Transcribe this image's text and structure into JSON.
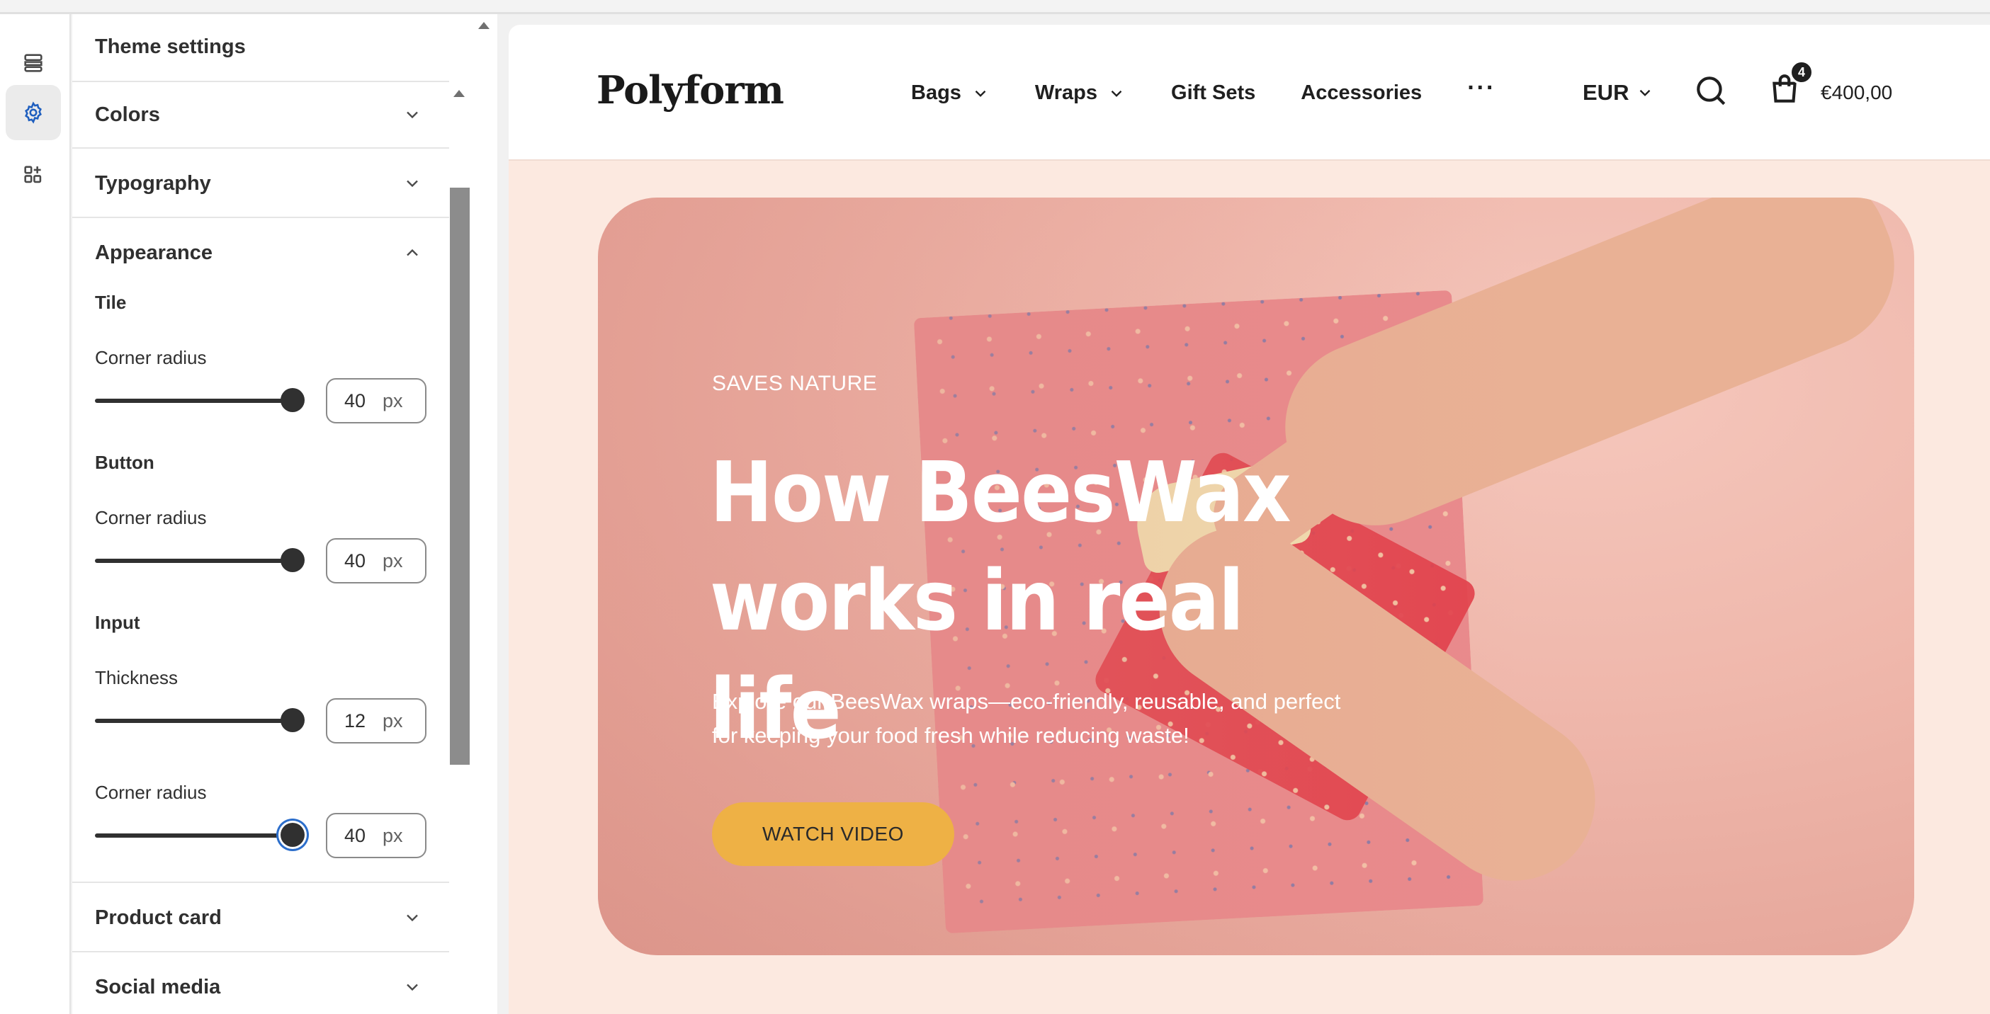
{
  "rail": {
    "items": [
      {
        "name": "sections",
        "icon": "sections-icon"
      },
      {
        "name": "theme-settings",
        "icon": "gear-icon",
        "active": true
      },
      {
        "name": "apps",
        "icon": "app-blocks-icon"
      }
    ]
  },
  "panel": {
    "title": "Theme settings",
    "sections": {
      "colors": "Colors",
      "typography": "Typography",
      "appearance": "Appearance",
      "product_card": "Product card",
      "social_media": "Social media"
    },
    "appearance": {
      "tile": {
        "title": "Tile",
        "corner_radius_label": "Corner radius",
        "corner_radius_value": "40",
        "unit": "px"
      },
      "button": {
        "title": "Button",
        "corner_radius_label": "Corner radius",
        "corner_radius_value": "40",
        "unit": "px"
      },
      "input": {
        "title": "Input",
        "thickness_label": "Thickness",
        "thickness_value": "12",
        "corner_radius_label": "Corner radius",
        "corner_radius_value": "40",
        "unit": "px"
      }
    }
  },
  "store": {
    "logo": "Polyform",
    "nav": {
      "bags": "Bags",
      "wraps": "Wraps",
      "gift_sets": "Gift Sets",
      "accessories": "Accessories",
      "more": "···"
    },
    "currency": "EUR",
    "cart_count": "4",
    "cart_total": "€400,00"
  },
  "hero": {
    "eyebrow": "SAVES NATURE",
    "headline_line1": "How BeesWax",
    "headline_line2": "works in real life",
    "lede_line1": "Explore our BeesWax wraps—eco-friendly, reusable, and perfect",
    "lede_line2": "for keeping your food fresh while reducing waste!",
    "cta": "WATCH VIDEO"
  },
  "colors": {
    "accent_button": "#eeb145",
    "hero_bg": "#fce9e0",
    "focus_ring": "#2c6ecb"
  }
}
